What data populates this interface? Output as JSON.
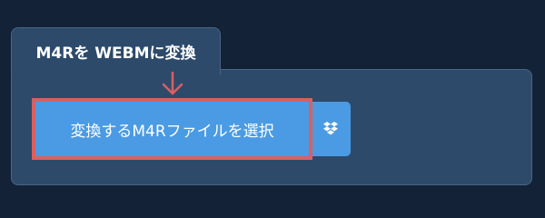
{
  "converter": {
    "title": "M4Rを WEBMに変換",
    "select_file_label": "変換するM4Rファイルを選択",
    "dropbox_icon": "dropbox-icon",
    "hint_arrow_icon": "down-arrow-icon"
  },
  "colors": {
    "page_background": "#132237",
    "panel_background": "#2d4a6b",
    "panel_border": "#4a6584",
    "button_background": "#4a9be4",
    "highlight_border": "#d86062",
    "text": "#ffffff"
  }
}
